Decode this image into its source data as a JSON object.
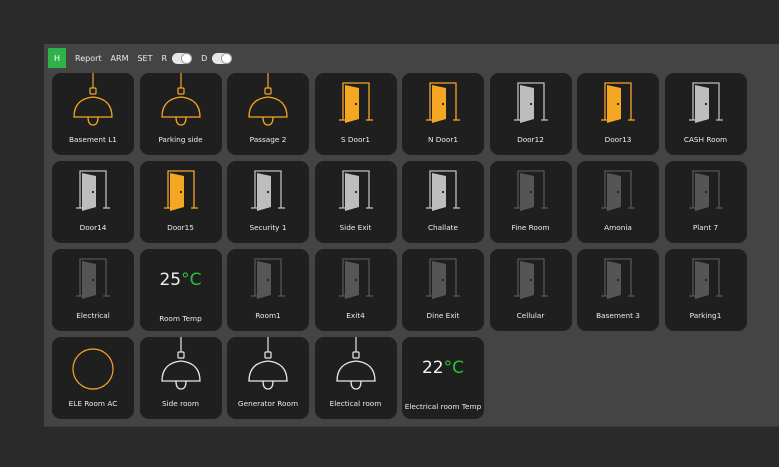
{
  "toolbar": {
    "home_label": "H",
    "items": [
      "Report",
      "ARM",
      "SET"
    ],
    "toggles": [
      {
        "label": "R",
        "state": "on"
      },
      {
        "label": "D",
        "state": "on"
      }
    ]
  },
  "colors": {
    "active": "#f5a623",
    "inactive_light": "#bdbdbd",
    "inactive_dark": "#555555",
    "temp_unit": "#26c23a",
    "home_button": "#2fb24a"
  },
  "tiles": [
    {
      "label": "Basement L1",
      "type": "lamp",
      "state": "on"
    },
    {
      "label": "Parking side",
      "type": "lamp",
      "state": "on"
    },
    {
      "label": "Passage 2",
      "type": "lamp",
      "state": "on"
    },
    {
      "label": "S Door1",
      "type": "door",
      "state": "open"
    },
    {
      "label": "N Door1",
      "type": "door",
      "state": "open"
    },
    {
      "label": "Door12",
      "type": "door",
      "state": "closed"
    },
    {
      "label": "Door13",
      "type": "door",
      "state": "open"
    },
    {
      "label": "CASH Room",
      "type": "door",
      "state": "closed"
    },
    {
      "label": "Door14",
      "type": "door",
      "state": "closed"
    },
    {
      "label": "Door15",
      "type": "door",
      "state": "open"
    },
    {
      "label": "Security 1",
      "type": "door",
      "state": "closed"
    },
    {
      "label": "Side Exit",
      "type": "door",
      "state": "closed"
    },
    {
      "label": "Challate",
      "type": "door",
      "state": "closed"
    },
    {
      "label": "Fine Room",
      "type": "door",
      "state": "offline"
    },
    {
      "label": "Amonia",
      "type": "door",
      "state": "offline"
    },
    {
      "label": "Plant 7",
      "type": "door",
      "state": "offline"
    },
    {
      "label": "Electrical",
      "type": "door",
      "state": "offline"
    },
    {
      "label": "Room Temp",
      "type": "temp",
      "value": "25",
      "unit": "°C"
    },
    {
      "label": "Room1",
      "type": "door",
      "state": "offline"
    },
    {
      "label": "Exit4",
      "type": "door",
      "state": "offline"
    },
    {
      "label": "Dine Exit",
      "type": "door",
      "state": "offline"
    },
    {
      "label": "Cellular",
      "type": "door",
      "state": "offline"
    },
    {
      "label": "Basement 3",
      "type": "door",
      "state": "offline"
    },
    {
      "label": "Parking1",
      "type": "door",
      "state": "offline"
    },
    {
      "label": "ELE Room AC",
      "type": "ac",
      "state": "on"
    },
    {
      "label": "Side room",
      "type": "lamp",
      "state": "off"
    },
    {
      "label": "Generator Room",
      "type": "lamp",
      "state": "off"
    },
    {
      "label": "Electical room",
      "type": "lamp",
      "state": "off"
    },
    {
      "label": "Electrical room Temp",
      "type": "temp",
      "value": "22",
      "unit": "°C"
    }
  ]
}
